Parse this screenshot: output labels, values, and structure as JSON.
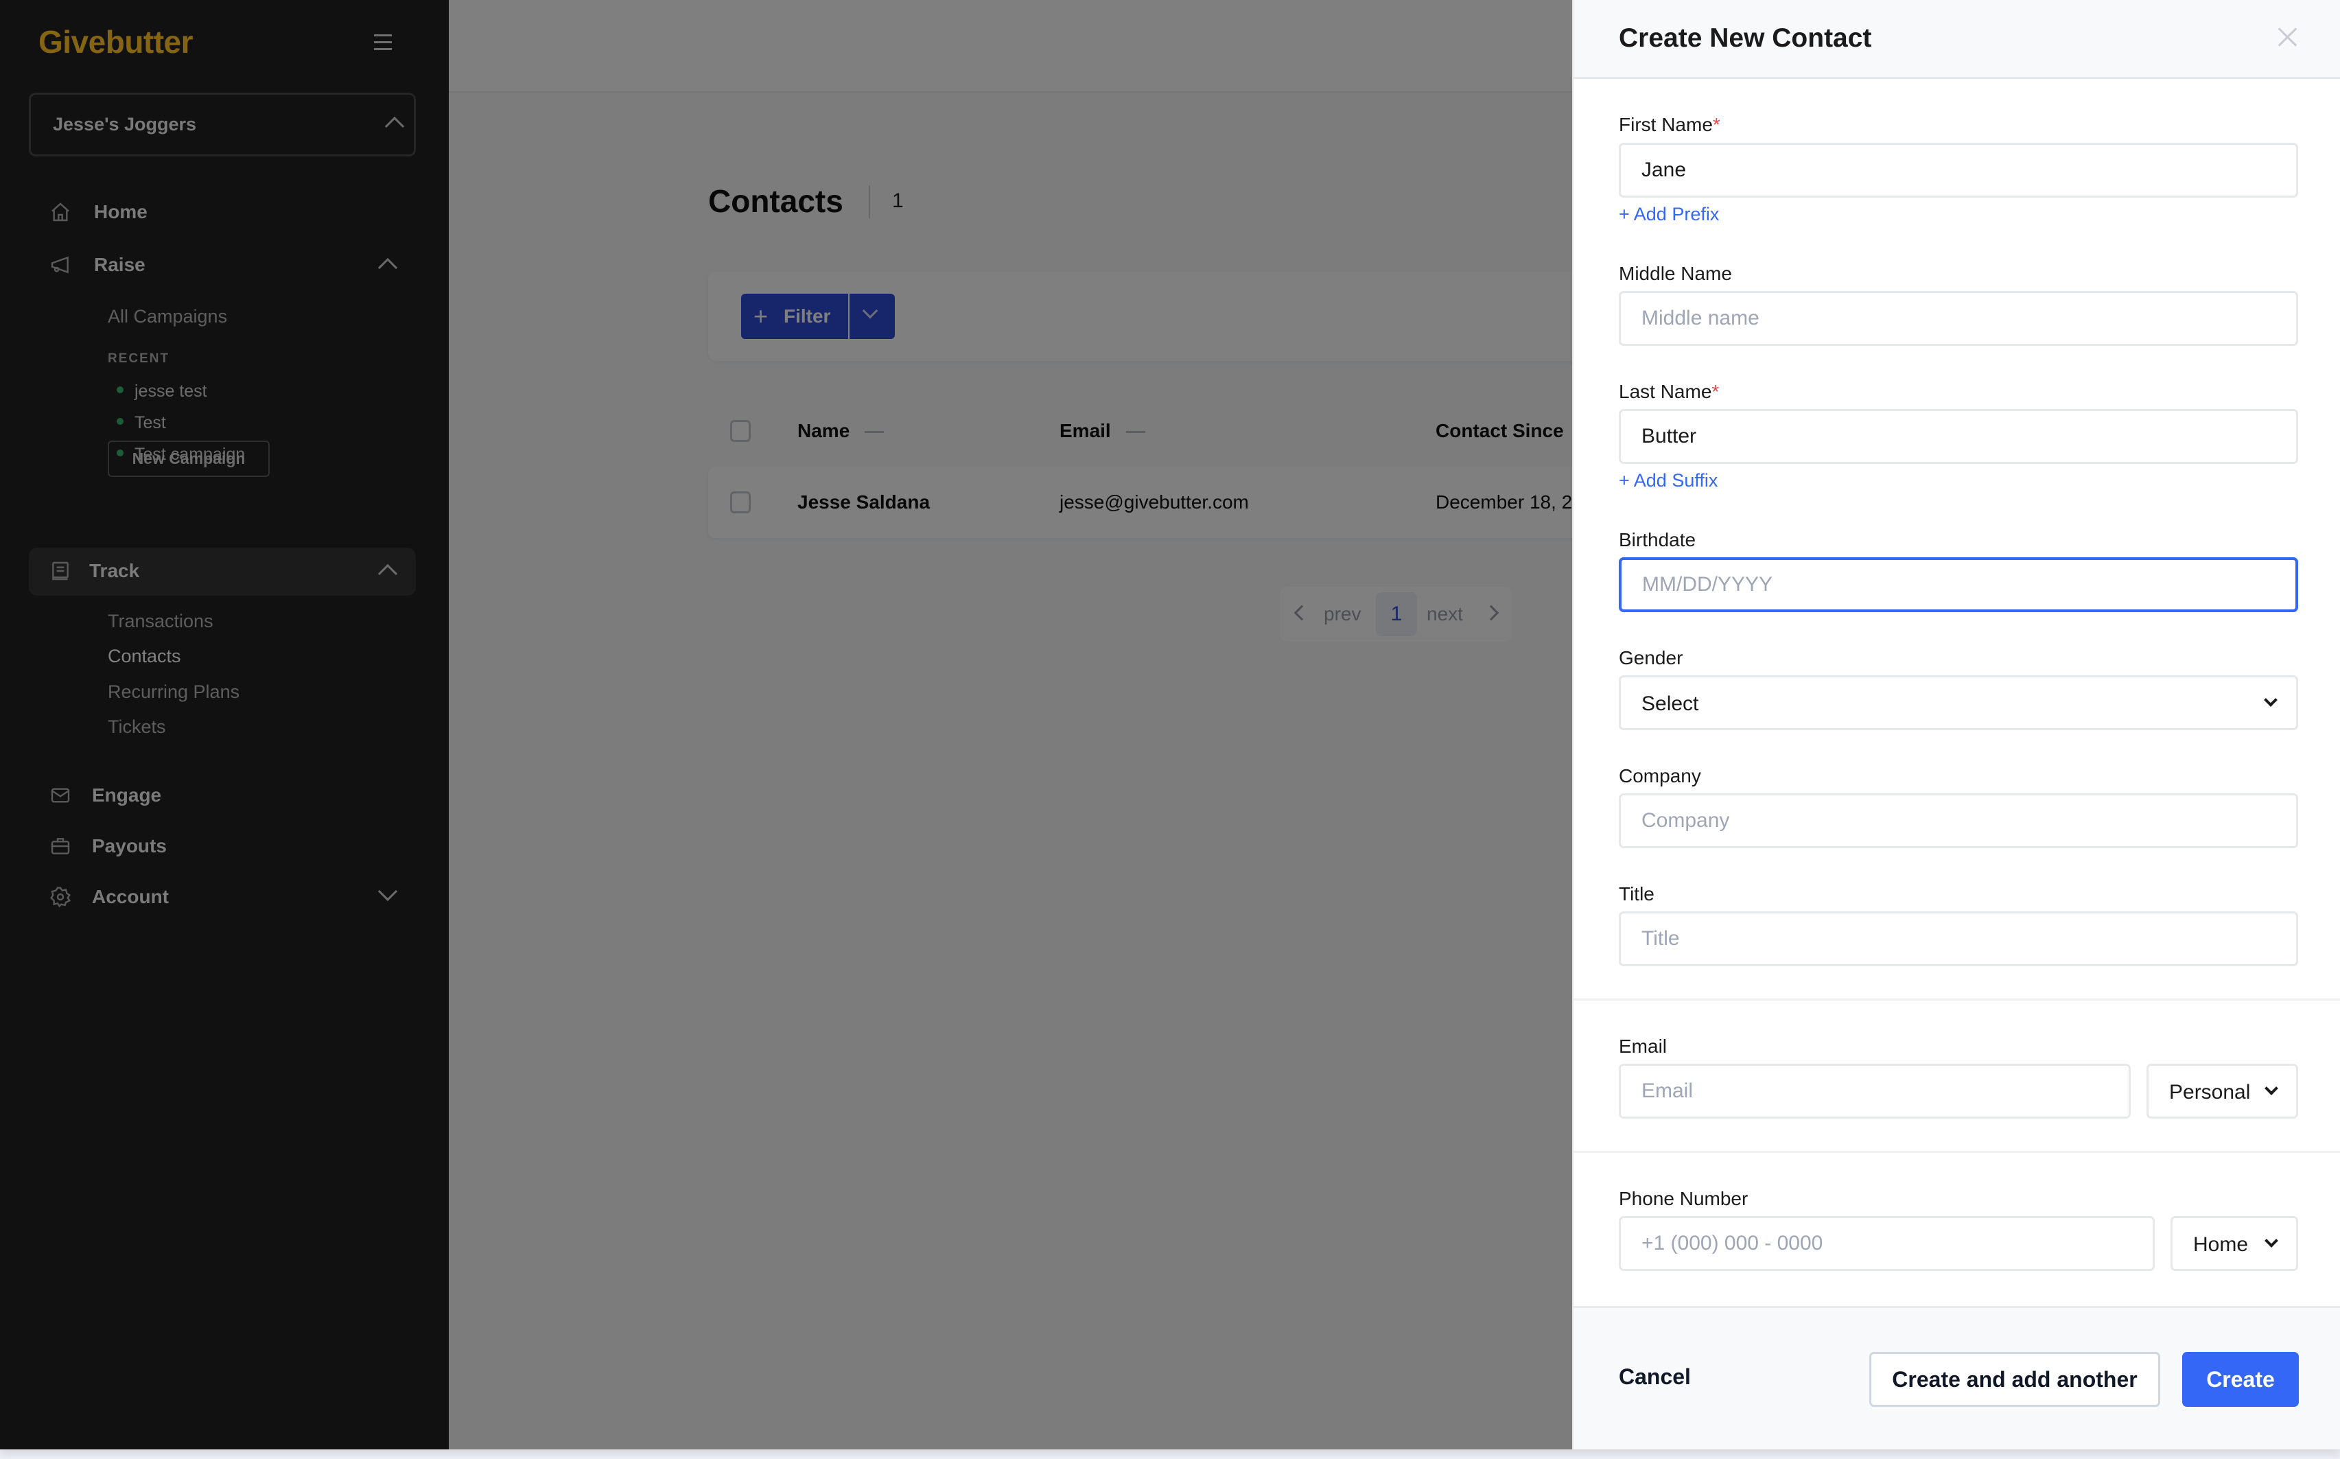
{
  "brand": {
    "logo": "Givebutter",
    "logo_color": "#856514"
  },
  "sidebar": {
    "org_name": "Jesse's Joggers",
    "nav": {
      "home": "Home",
      "raise": "Raise",
      "track": "Track",
      "engage": "Engage",
      "payouts": "Payouts",
      "account": "Account"
    },
    "raise_sub": {
      "all_campaigns": "All Campaigns",
      "recent_label": "RECENT",
      "recent": [
        "jesse test",
        "Test",
        "Test campaign"
      ],
      "new_campaign": "New Campaign"
    },
    "track_sub": [
      "Transactions",
      "Contacts",
      "Recurring Plans",
      "Tickets"
    ]
  },
  "main": {
    "title": "Contacts",
    "count": "1",
    "filter_label": "Filter",
    "columns": [
      "Name",
      "Email",
      "Contact Since"
    ],
    "rows": [
      {
        "name": "Jesse Saldana",
        "email": "jesse@givebutter.com",
        "contact_since": "December 18, 2"
      }
    ],
    "pagination": {
      "prev": "prev",
      "current": "1",
      "next": "next"
    }
  },
  "drawer": {
    "title": "Create New Contact",
    "fields": {
      "first_name": {
        "label": "First Name",
        "required": "*",
        "value": "Jane",
        "link": "+ Add Prefix"
      },
      "middle_name": {
        "label": "Middle Name",
        "placeholder": "Middle name"
      },
      "last_name": {
        "label": "Last Name",
        "required": "*",
        "value": "Butter",
        "link": "+ Add Suffix"
      },
      "birthdate": {
        "label": "Birthdate",
        "placeholder": "MM/DD/YYYY"
      },
      "gender": {
        "label": "Gender",
        "selected": "Select"
      },
      "company": {
        "label": "Company",
        "placeholder": "Company"
      },
      "title": {
        "label": "Title",
        "placeholder": "Title"
      },
      "email": {
        "label": "Email",
        "placeholder": "Email",
        "type": "Personal"
      },
      "phone": {
        "label": "Phone Number",
        "placeholder": "+1 (000) 000 - 0000",
        "type": "Home"
      }
    },
    "footer": {
      "cancel": "Cancel",
      "create_another": "Create and add another",
      "create": "Create"
    }
  },
  "colors": {
    "primary": "#3467f5",
    "filter_button": "#2f4dd6",
    "required": "#e5484d",
    "sidebar_bg": "#111111"
  }
}
